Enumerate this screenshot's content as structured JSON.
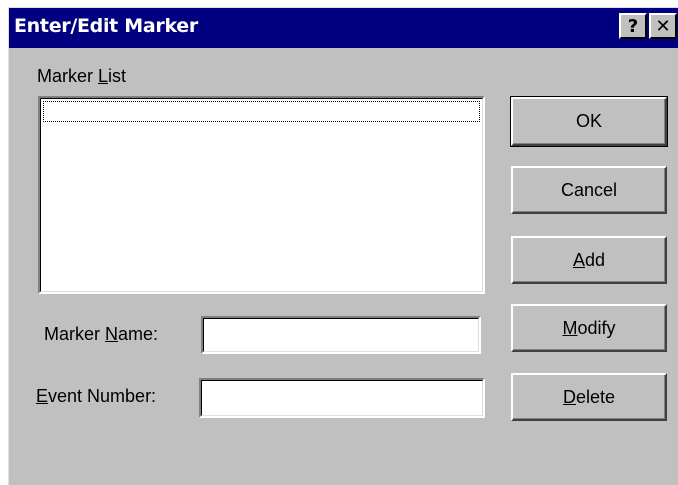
{
  "window": {
    "title": "Enter/Edit Marker",
    "help_glyph": "?",
    "close_glyph": "✕"
  },
  "marker_list": {
    "label_pre": "Marker ",
    "label_key": "L",
    "label_post": "ist",
    "items": []
  },
  "marker_name": {
    "label_pre": "Marker ",
    "label_key": "N",
    "label_post": "ame:",
    "value": ""
  },
  "event_number": {
    "label_pre": "",
    "label_key": "E",
    "label_post": "vent Number:",
    "value": ""
  },
  "buttons": {
    "ok": {
      "pre": "",
      "key": "",
      "post": "OK"
    },
    "cancel": {
      "pre": "",
      "key": "",
      "post": "Cancel"
    },
    "add": {
      "pre": "",
      "key": "A",
      "post": "dd"
    },
    "modify": {
      "pre": "",
      "key": "M",
      "post": "odify"
    },
    "delete": {
      "pre": "",
      "key": "D",
      "post": "elete"
    }
  }
}
